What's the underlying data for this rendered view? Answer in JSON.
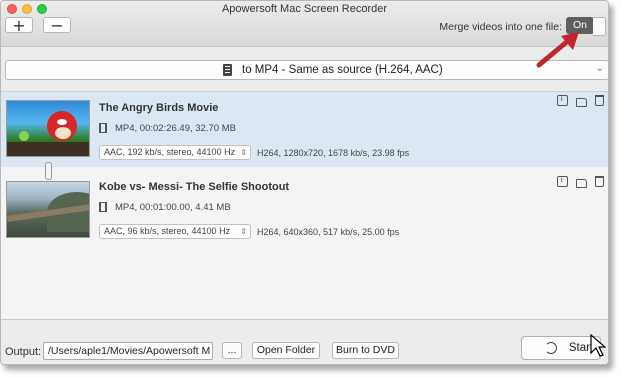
{
  "window": {
    "title": "Apowersoft Mac Screen Recorder"
  },
  "toolbar": {
    "add_label": "+",
    "remove_label": "−",
    "merge_label": "Merge videos into one file:",
    "merge_value": "On"
  },
  "format_bar": {
    "text": "to MP4 - Same as source (H.264, AAC)"
  },
  "items": [
    {
      "title": "The Angry Birds Movie",
      "meta": "MP4, 00:02:26.49, 32.70 MB",
      "audio": "AAC, 192 kb/s, stereo, 44100 Hz",
      "video": "H264, 1280x720, 1678 kb/s, 23.98 fps",
      "selected": true
    },
    {
      "title": "Kobe vs- Messi- The Selfie Shootout",
      "meta": "MP4, 00:01:00.00, 4.41 MB",
      "audio": "AAC, 96 kb/s, stereo, 44100 Hz",
      "video": "H264, 640x360, 517 kb/s, 25.00 fps",
      "selected": false
    }
  ],
  "bottom": {
    "output_label": "Output:",
    "output_path": "/Users/aple1/Movies/Apowersoft M",
    "browse_label": "...",
    "open_folder_label": "Open Folder",
    "burn_dvd_label": "Burn to DVD",
    "start_label": "Start"
  },
  "colors": {
    "selected_row": "#dbe8f3",
    "toggle_on": "#5f5f5f",
    "annotation_arrow": "#c0262b"
  }
}
